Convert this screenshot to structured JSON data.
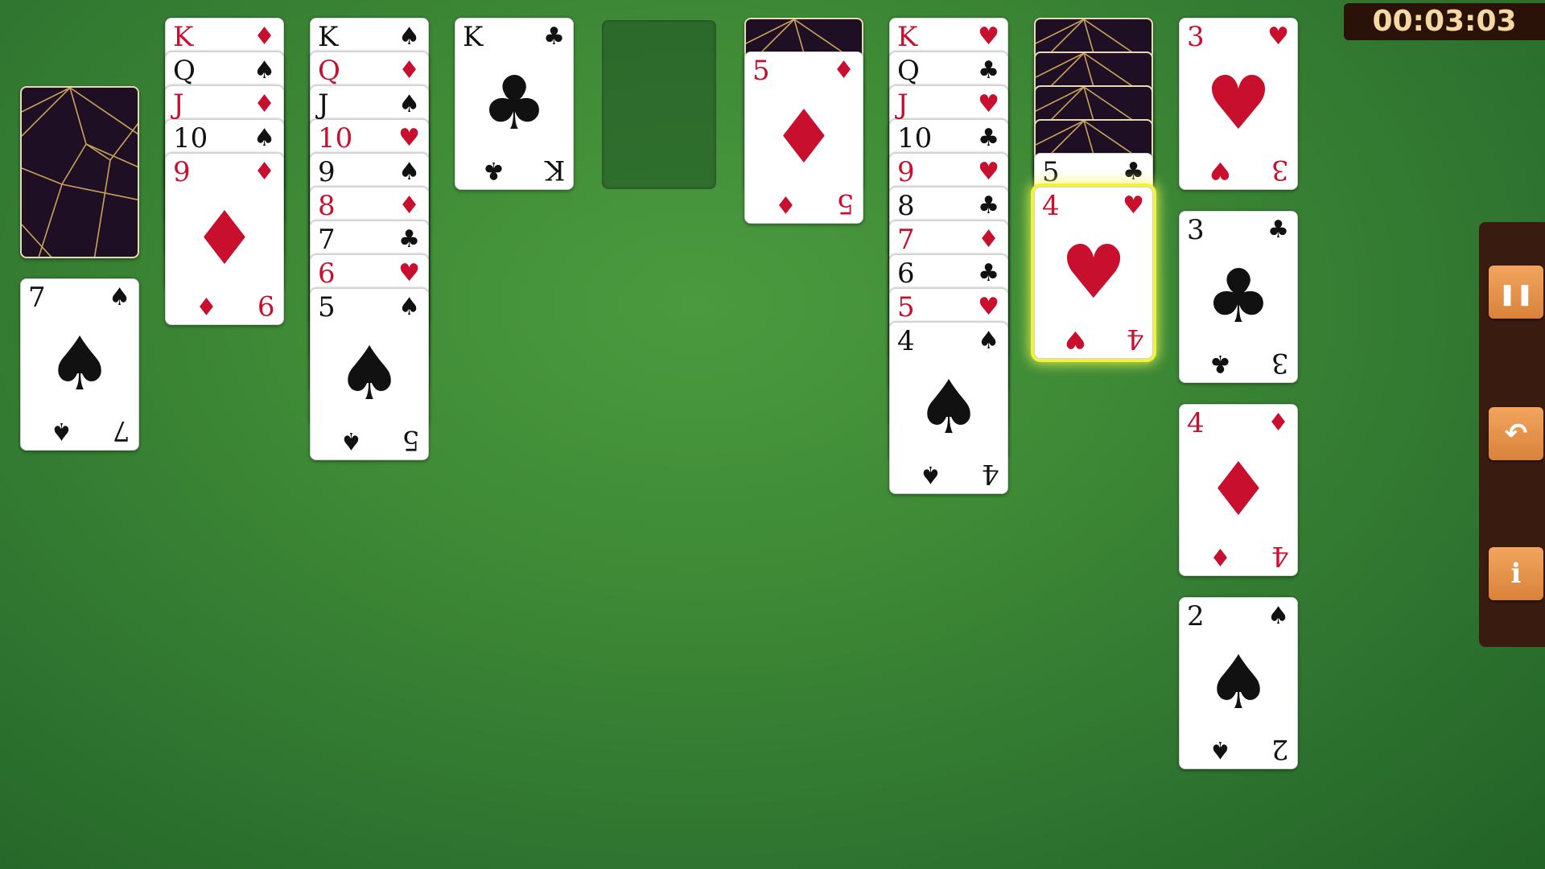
{
  "timer": "00:03:03",
  "stock": {
    "face_down": true
  },
  "waste": [
    {
      "rank": "7",
      "suit": "♠",
      "color": "black"
    }
  ],
  "tableau": [
    {
      "down": 0,
      "cards": [
        {
          "rank": "K",
          "suit": "♦",
          "color": "red"
        },
        {
          "rank": "Q",
          "suit": "♠",
          "color": "black"
        },
        {
          "rank": "J",
          "suit": "♦",
          "color": "red"
        },
        {
          "rank": "10",
          "suit": "♠",
          "color": "black"
        },
        {
          "rank": "9",
          "suit": "♦",
          "color": "red"
        }
      ]
    },
    {
      "down": 0,
      "cards": [
        {
          "rank": "K",
          "suit": "♠",
          "color": "black"
        },
        {
          "rank": "Q",
          "suit": "♦",
          "color": "red"
        },
        {
          "rank": "J",
          "suit": "♠",
          "color": "black"
        },
        {
          "rank": "10",
          "suit": "♥",
          "color": "red"
        },
        {
          "rank": "9",
          "suit": "♠",
          "color": "black"
        },
        {
          "rank": "8",
          "suit": "♦",
          "color": "red"
        },
        {
          "rank": "7",
          "suit": "♣",
          "color": "black"
        },
        {
          "rank": "6",
          "suit": "♥",
          "color": "red"
        },
        {
          "rank": "5",
          "suit": "♠",
          "color": "black"
        }
      ]
    },
    {
      "down": 0,
      "cards": [
        {
          "rank": "K",
          "suit": "♣",
          "color": "black"
        }
      ]
    },
    {
      "down": 0,
      "empty": true,
      "cards": []
    },
    {
      "down": 1,
      "cards": [
        {
          "rank": "5",
          "suit": "♦",
          "color": "red"
        }
      ]
    },
    {
      "down": 0,
      "cards": [
        {
          "rank": "K",
          "suit": "♥",
          "color": "red"
        },
        {
          "rank": "Q",
          "suit": "♣",
          "color": "black"
        },
        {
          "rank": "J",
          "suit": "♥",
          "color": "red"
        },
        {
          "rank": "10",
          "suit": "♣",
          "color": "black"
        },
        {
          "rank": "9",
          "suit": "♥",
          "color": "red"
        },
        {
          "rank": "8",
          "suit": "♣",
          "color": "black"
        },
        {
          "rank": "7",
          "suit": "♦",
          "color": "red"
        },
        {
          "rank": "6",
          "suit": "♣",
          "color": "black"
        },
        {
          "rank": "5",
          "suit": "♥",
          "color": "red"
        },
        {
          "rank": "4",
          "suit": "♠",
          "color": "black"
        }
      ]
    },
    {
      "down": 4,
      "selected_index": 1,
      "cards": [
        {
          "rank": "5",
          "suit": "♣",
          "color": "black"
        },
        {
          "rank": "4",
          "suit": "♥",
          "color": "red"
        }
      ]
    }
  ],
  "foundations": [
    {
      "rank": "3",
      "suit": "♥",
      "color": "red"
    },
    {
      "rank": "3",
      "suit": "♣",
      "color": "black"
    },
    {
      "rank": "4",
      "suit": "♦",
      "color": "red"
    },
    {
      "rank": "2",
      "suit": "♠",
      "color": "black"
    }
  ],
  "controls": {
    "pause": {
      "icon": "pause-icon",
      "glyph": "❚❚"
    },
    "undo": {
      "icon": "undo-icon",
      "glyph": "↶"
    },
    "info": {
      "icon": "info-icon",
      "glyph": "i"
    }
  },
  "colors": {
    "table": "#3e8a36",
    "red_suit": "#c8102e",
    "black_suit": "#111111",
    "highlight": "#f2f23a",
    "button": "#e8924a"
  }
}
